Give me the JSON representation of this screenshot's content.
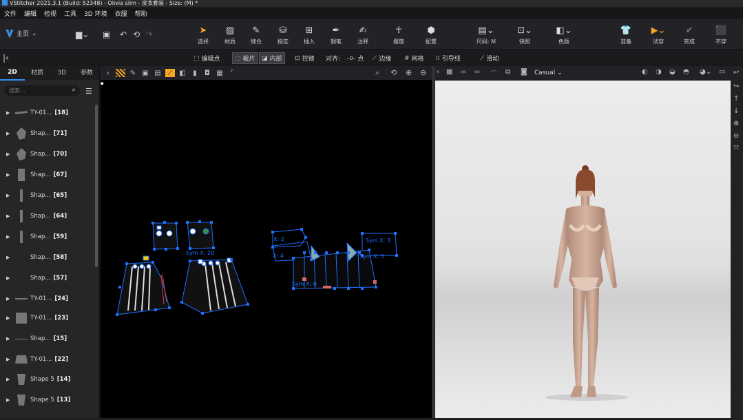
{
  "window": {
    "title": "VStitcher 2021.3.1 (Build: 52348) - Olivia slim - 皮衣套装 - Size: (M) *"
  },
  "menu": [
    "文件",
    "编辑",
    "检视",
    "工具",
    "3D 环境",
    "衣服",
    "帮助"
  ],
  "toolbar": {
    "home_label": "主页",
    "tools": [
      {
        "label": "选择",
        "icon": "pointer-icon"
      },
      {
        "label": "材质",
        "icon": "hatch-icon"
      },
      {
        "label": "缝合",
        "icon": "stitch-icon"
      },
      {
        "label": "指定",
        "icon": "bucket-icon"
      },
      {
        "label": "插入",
        "icon": "plus-icon"
      },
      {
        "label": "钢笔",
        "icon": "pen-icon"
      },
      {
        "label": "注释",
        "icon": "note-icon"
      },
      {
        "label": "摆放",
        "icon": "avatar-icon"
      },
      {
        "label": "配置",
        "icon": "cube-icon"
      },
      {
        "label": "尺码: M",
        "icon": "size-icon"
      },
      {
        "label": "快照",
        "icon": "snapshot-icon"
      },
      {
        "label": "色版",
        "icon": "colorway-icon"
      },
      {
        "label": "准备",
        "icon": "shirt-icon"
      },
      {
        "label": "试穿",
        "icon": "play-icon"
      },
      {
        "label": "完成",
        "icon": "check-icon"
      },
      {
        "label": "不穿",
        "icon": "undress-icon"
      }
    ]
  },
  "subbar": {
    "items": [
      "编辑点",
      "裁片",
      "内部",
      "控键",
      "对齐:",
      "点",
      "边缘",
      "网格",
      "引导线",
      "滑动"
    ]
  },
  "sidepanel": {
    "tabs": [
      "2D",
      "材质",
      "3D",
      "参数"
    ],
    "search_placeholder": "搜索...",
    "items": [
      {
        "name": "TY-01...",
        "count": "[18]"
      },
      {
        "name": "Shap...",
        "count": "[71]"
      },
      {
        "name": "Shap...",
        "count": "[70]"
      },
      {
        "name": "Shap...",
        "count": "[67]"
      },
      {
        "name": "Shap...",
        "count": "[65]"
      },
      {
        "name": "Shap...",
        "count": "[64]"
      },
      {
        "name": "Shap...",
        "count": "[59]"
      },
      {
        "name": "Shap...",
        "count": "[58]"
      },
      {
        "name": "Shap...",
        "count": "[57]"
      },
      {
        "name": "TY-01...",
        "count": "[24]"
      },
      {
        "name": "TY-01...",
        "count": "[23]"
      },
      {
        "name": "Shap...",
        "count": "[15]"
      },
      {
        "name": "TY-01...",
        "count": "[22]"
      },
      {
        "name": "Shape 5",
        "count": "[14]"
      },
      {
        "name": "Shape 5",
        "count": "[13]"
      }
    ]
  },
  "view2d": {
    "labels": [
      "Sym X: 20",
      "X: 2",
      "X: 4",
      "Sym X: 3",
      "Sym X: 5",
      "Sym X: 6"
    ]
  },
  "view3d": {
    "environment": "Casual"
  },
  "colors": {
    "accent": "#2d8ff0",
    "handles": "#1e6fff",
    "highlight": "#f5a623"
  }
}
